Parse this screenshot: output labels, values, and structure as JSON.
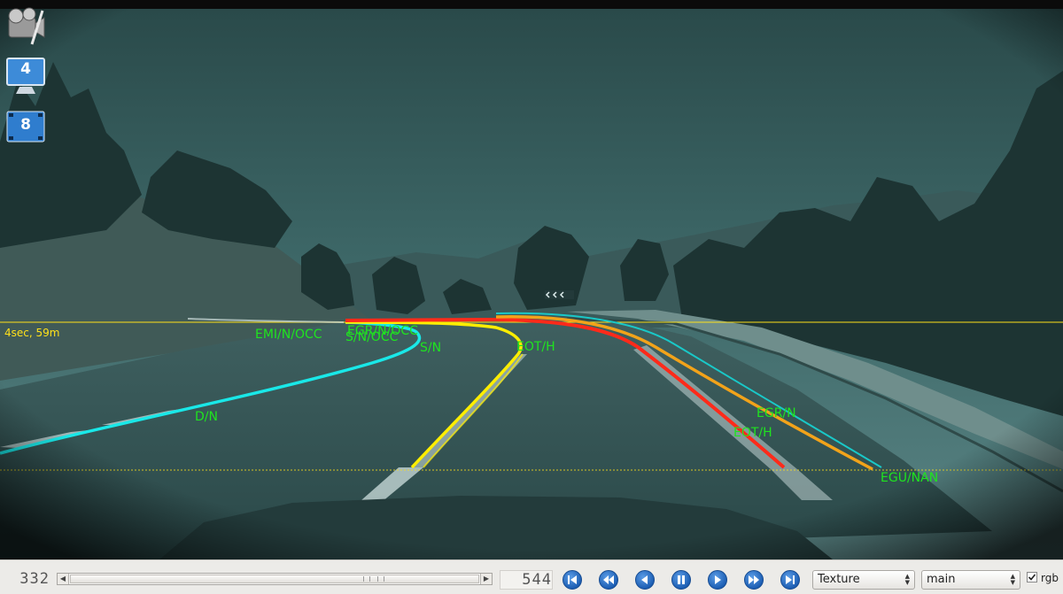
{
  "viewer": {
    "horizon_text": "4sec, 59m",
    "lane_labels": [
      {
        "id": "emi-n-occ",
        "text": "EMI/N/OCC"
      },
      {
        "id": "egr-n-occ",
        "text": "EGR/N/OCC"
      },
      {
        "id": "s-n-occ",
        "text": "S/N/OCC"
      },
      {
        "id": "s-n",
        "text": "S/N"
      },
      {
        "id": "eot-h-top",
        "text": "EOT/H"
      },
      {
        "id": "d-n",
        "text": "D/N"
      },
      {
        "id": "egr-n",
        "text": "EGR/N"
      },
      {
        "id": "eot-h-bottom",
        "text": "EOT/H"
      },
      {
        "id": "egu-nan",
        "text": "EGU/NAN"
      }
    ],
    "desktop_icons": [
      {
        "name": "video-tool-icon"
      },
      {
        "name": "workspace-4-icon",
        "number": "4"
      },
      {
        "name": "workspace-8-icon",
        "number": "8"
      }
    ],
    "colors": {
      "label_green": "#1fe41f",
      "horizon_yellow": "#ffe11a",
      "lane_cyan": "#19e8e8",
      "lane_yellow": "#ffee00",
      "lane_red": "#ff2a1a",
      "lane_orange": "#f2a31a",
      "scene_tint": "#3d6868"
    }
  },
  "toolbar": {
    "current_frame": "332",
    "total_frames": "544",
    "scroll_position": 0.7,
    "buttons": [
      "first-frame",
      "rewind",
      "step-back",
      "pause",
      "play",
      "fast-forward",
      "last-frame"
    ],
    "texture_select": "Texture",
    "channel_select": "main",
    "rgb_label": "rgb",
    "rgb_checked": true
  }
}
